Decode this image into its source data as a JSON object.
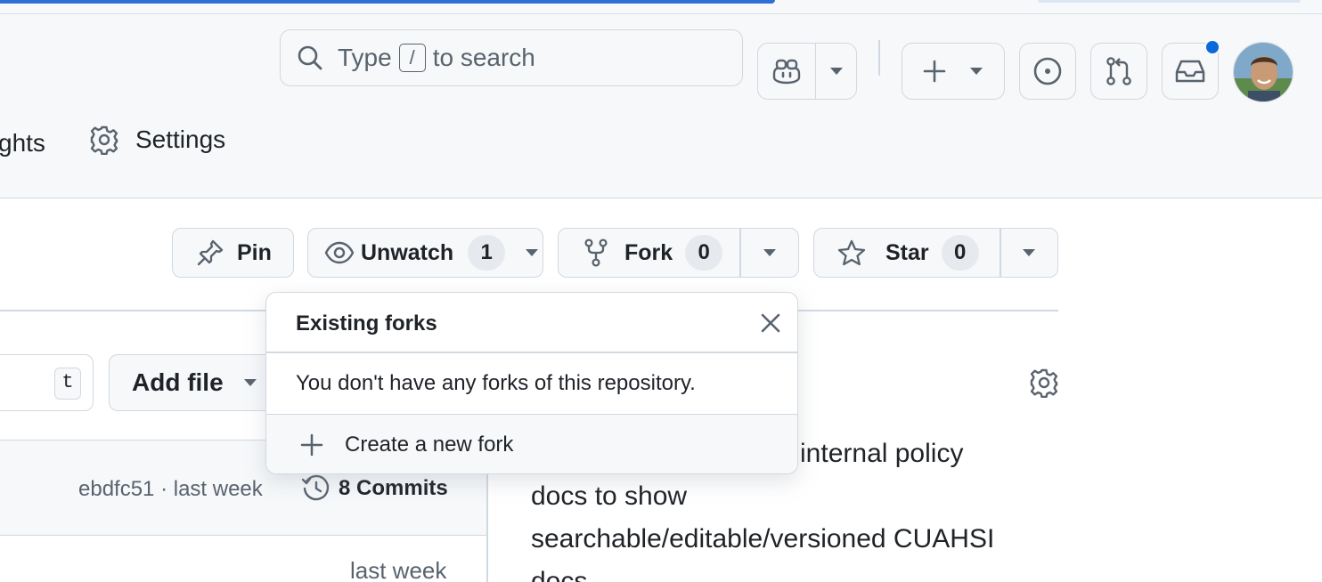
{
  "header": {
    "search": {
      "prefix": "Type",
      "key": "/",
      "suffix": "to search"
    }
  },
  "repo_nav": {
    "partial_tab": "ghts",
    "settings_label": "Settings"
  },
  "repo_actions": {
    "pin_label": "Pin",
    "unwatch_label": "Unwatch",
    "unwatch_count": "1",
    "fork_label": "Fork",
    "fork_count": "0",
    "star_label": "Star",
    "star_count": "0"
  },
  "file_toolbar": {
    "goto_key": "t",
    "add_file_label": "Add file"
  },
  "latest_commit": {
    "meta": "ebdfc51 · last week",
    "commits_label": "8 Commits"
  },
  "file_rows": [
    {
      "time": "last week"
    }
  ],
  "about": {
    "line1": "e internal policy",
    "line2": "docs to show",
    "line3": "searchable/editable/versioned CUAHSI",
    "line4": "docs"
  },
  "fork_popover": {
    "title": "Existing forks",
    "empty_text": "You don't have any forks of this repository.",
    "create_label": "Create a new fork"
  },
  "colors": {
    "accent": "#0969da",
    "border": "#d1d9e0",
    "canvas_subtle": "#f6f8fa"
  }
}
